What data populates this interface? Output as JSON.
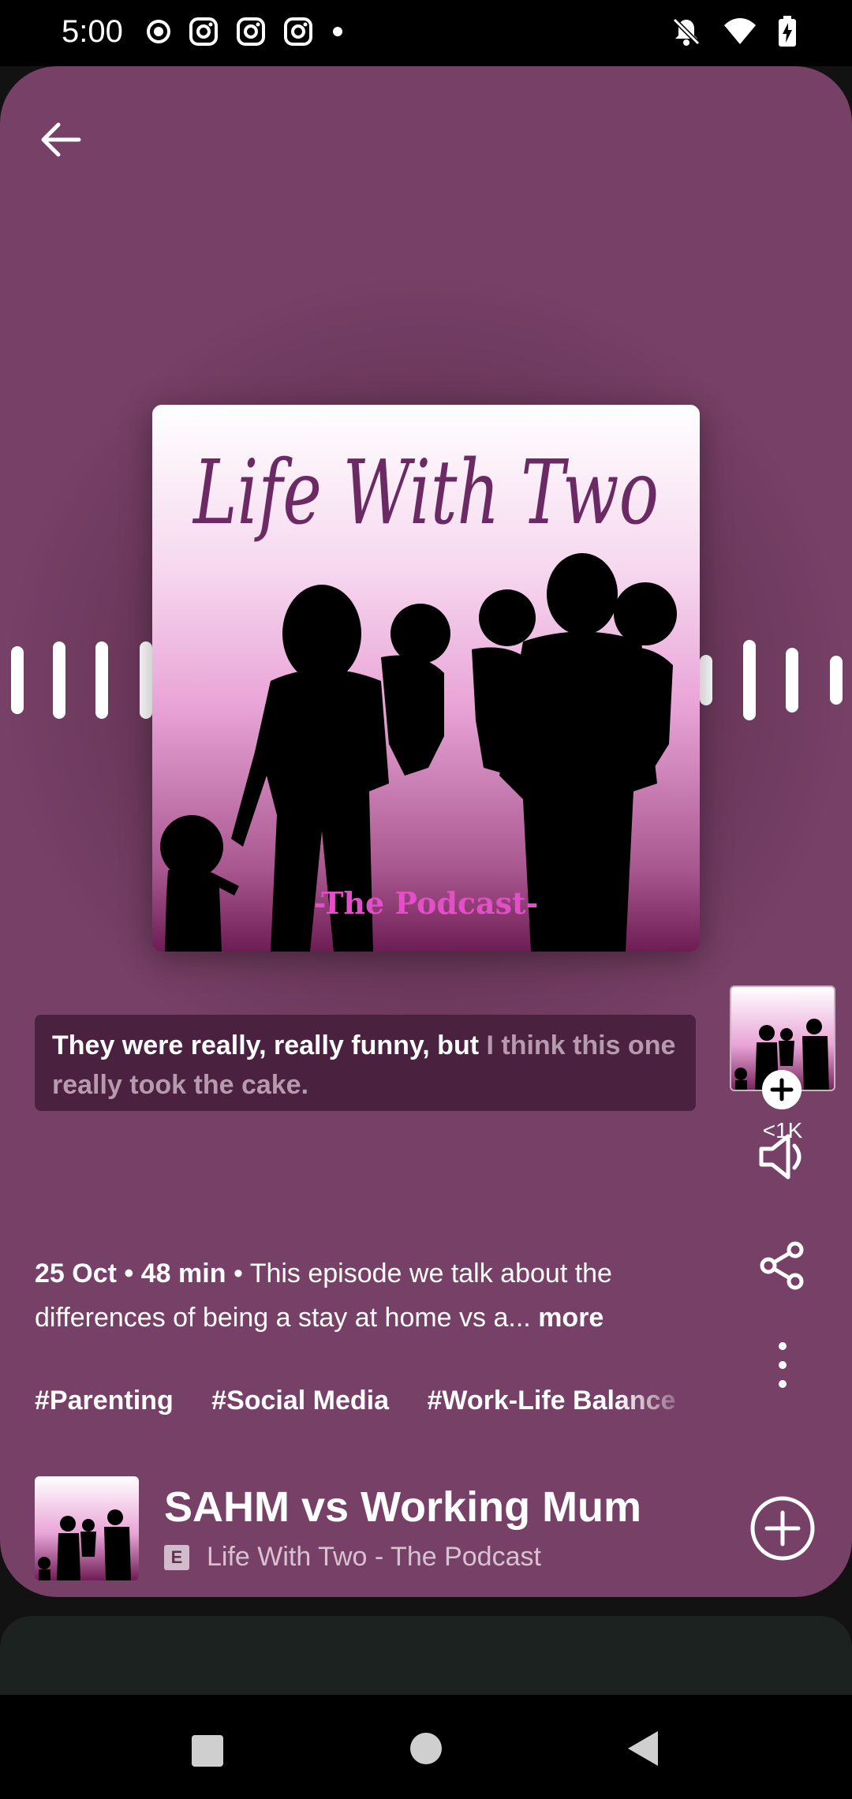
{
  "status_bar": {
    "time": "5:00",
    "left_icons": [
      "record-icon",
      "instagram-icon",
      "instagram-icon",
      "instagram-icon",
      "dot-icon"
    ],
    "right_icons": [
      "bell-off-icon",
      "wifi-icon",
      "battery-charging-icon"
    ]
  },
  "player": {
    "cover": {
      "title_script": "Life With Two",
      "subtitle": "-The Podcast-"
    },
    "caption": {
      "spoken": "They were really, really funny, but ",
      "unspoken": "I think this one really took the cake."
    },
    "side": {
      "count": "<1K"
    },
    "description": {
      "date": "25 Oct",
      "separator": "•",
      "duration": "48 min",
      "text": "This episode we talk about the differences of being a stay at home vs a...",
      "more_label": "more"
    },
    "tags": [
      "#Parenting",
      "#Social Media",
      "#Work-Life Balance"
    ],
    "episode": {
      "title": "SAHM vs Working Mum",
      "explicit_badge": "E",
      "show": "Life With Two - The Podcast"
    },
    "progress_fraction": 0.94
  },
  "colors": {
    "card_background": "#774066",
    "caption_background": "#4a2240",
    "subtitle_pink": "#e24fc6"
  }
}
